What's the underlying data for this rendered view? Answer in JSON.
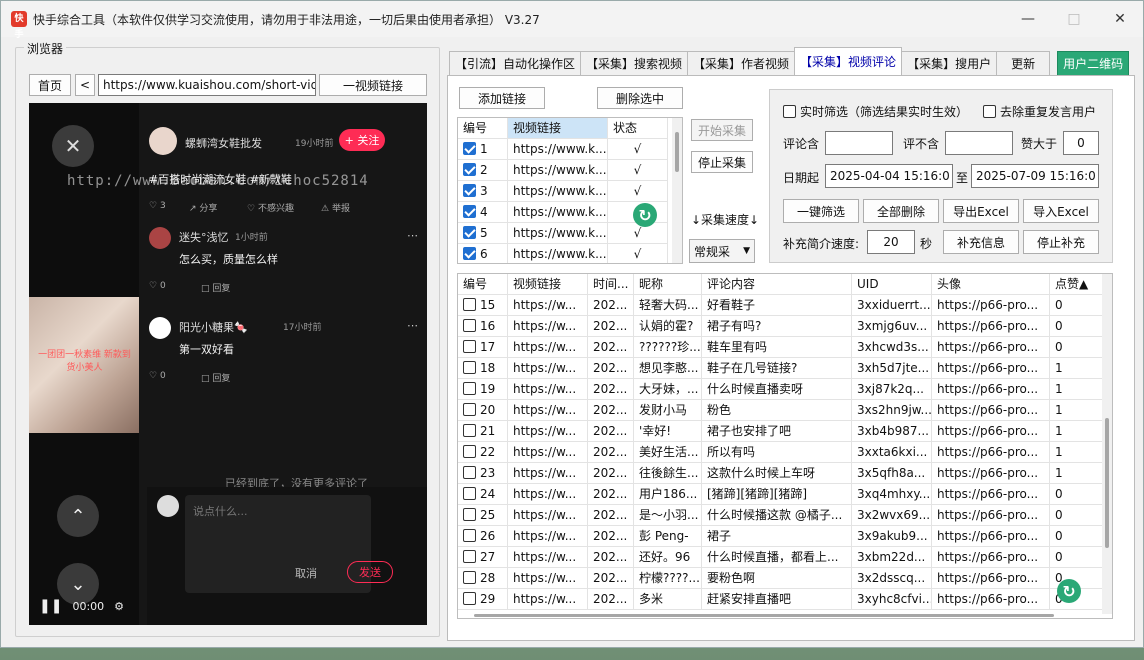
{
  "window": {
    "title": "快手综合工具（本软件仅供学习交流使用，请勿用于非法用途，一切后果由使用者承担） V3.27",
    "icon_label": "快手"
  },
  "browser": {
    "group_label": "浏览器",
    "home_label": "首页",
    "back_label": "<",
    "url_value": "https://www.kuaishou.com/short-vide",
    "go_label": "一视频链接",
    "overlay_url": "http://www.baoban.com/ichoc52814",
    "thumb_text": "一团团一秋素维 新款到货小美人",
    "time_label": "00:00",
    "comments": [
      {
        "name": "螺蛳湾女鞋批发",
        "time": "19小时前",
        "text": "#百搭时尚潮流女鞋 #新款鞋",
        "likes": "3",
        "share": "分享",
        "dislike": "不感兴趣",
        "report": "举报"
      },
      {
        "name": "迷失°浅忆",
        "time": "1小时前",
        "text": "怎么买，质量怎么样",
        "likes": "0",
        "reply": "回复"
      },
      {
        "name": "阳光小糖果🍬",
        "time": "17小时前",
        "text": "第一双好看",
        "likes": "0",
        "reply": "回复"
      }
    ],
    "follow_label": "+ 关注",
    "end_text": "已经到底了，没有更多评论了",
    "comment_placeholder": "说点什么...",
    "cancel_label": "取消",
    "send_label": "发送"
  },
  "tabs": [
    {
      "label": "【引流】自动化操作区",
      "active": false
    },
    {
      "label": "【采集】搜索视频",
      "active": false
    },
    {
      "label": "【采集】作者视频",
      "active": false
    },
    {
      "label": "【采集】视频评论",
      "active": true
    },
    {
      "label": "【采集】搜用户",
      "active": false
    },
    {
      "label": "更新",
      "active": false
    }
  ],
  "qr_button": "用户二维码",
  "video_list": {
    "add_label": "添加链接",
    "delete_label": "删除选中",
    "columns": [
      "编号",
      "视频链接",
      "状态"
    ],
    "rows": [
      {
        "no": "1",
        "link": "https://www.k...",
        "status": "√"
      },
      {
        "no": "2",
        "link": "https://www.k...",
        "status": "√"
      },
      {
        "no": "3",
        "link": "https://www.k...",
        "status": "√"
      },
      {
        "no": "4",
        "link": "https://www.k...",
        "status": "√"
      },
      {
        "no": "5",
        "link": "https://www.k...",
        "status": "√"
      },
      {
        "no": "6",
        "link": "https://www.k...",
        "status": "√"
      }
    ]
  },
  "controls": {
    "start_label": "开始采集",
    "stop_label": "停止采集",
    "speed_label": "↓采集速度↓",
    "speed_value": "常规采"
  },
  "filters": {
    "realtime_label": "实时筛选（筛选结果实时生效）",
    "dedupe_label": "去除重复发言用户",
    "include_label": "评论含",
    "exclude_label": "评不含",
    "likes_label": "赞大于",
    "likes_value": "0",
    "date_from_label": "日期起",
    "date_from": "2025-04-04 15:16:0",
    "date_to_label": "至",
    "date_to": "2025-07-09 15:16:0",
    "filter_label": "一键筛选",
    "delete_all_label": "全部删除",
    "export_label": "导出Excel",
    "import_label": "导入Excel",
    "speed_label": "补充简介速度:",
    "speed_value": "20",
    "speed_unit": "秒",
    "supplement_label": "补充信息",
    "stop_supplement_label": "停止补充"
  },
  "results": {
    "columns": [
      "编号",
      "视频链接",
      "时间...",
      "昵称",
      "评论内容",
      "UID",
      "头像",
      "点赞▲"
    ],
    "rows": [
      {
        "no": "15",
        "link": "https://w...",
        "time": "202...",
        "nick": "轻奢大码...",
        "content": "好看鞋子",
        "uid": "3xxiduerrt...",
        "avatar": "https://p66-pro...",
        "likes": "0"
      },
      {
        "no": "16",
        "link": "https://w...",
        "time": "202...",
        "nick": "认娟的霍?",
        "content": "裙子有吗?",
        "uid": "3xmjg6uv...",
        "avatar": "https://p66-pro...",
        "likes": "0"
      },
      {
        "no": "17",
        "link": "https://w...",
        "time": "202...",
        "nick": "??????珍...",
        "content": "鞋车里有吗",
        "uid": "3xhcwd3s...",
        "avatar": "https://p66-pro...",
        "likes": "0"
      },
      {
        "no": "18",
        "link": "https://w...",
        "time": "202...",
        "nick": "想见李憨...",
        "content": "鞋子在几号链接?",
        "uid": "3xh5d7jte...",
        "avatar": "https://p66-pro...",
        "likes": "1"
      },
      {
        "no": "19",
        "link": "https://w...",
        "time": "202...",
        "nick": "大牙妹，...",
        "content": "什么时候直播卖呀",
        "uid": "3xj87k2q...",
        "avatar": "https://p66-pro...",
        "likes": "1"
      },
      {
        "no": "20",
        "link": "https://w...",
        "time": "202...",
        "nick": "发财小马",
        "content": "粉色",
        "uid": "3xs2hn9jw...",
        "avatar": "https://p66-pro...",
        "likes": "1"
      },
      {
        "no": "21",
        "link": "https://w...",
        "time": "202...",
        "nick": "'幸好!",
        "content": "裙子也安排了吧",
        "uid": "3xb4b987...",
        "avatar": "https://p66-pro...",
        "likes": "1"
      },
      {
        "no": "22",
        "link": "https://w...",
        "time": "202...",
        "nick": "美好生活...",
        "content": "所以有吗",
        "uid": "3xxta6kxi...",
        "avatar": "https://p66-pro...",
        "likes": "1"
      },
      {
        "no": "23",
        "link": "https://w...",
        "time": "202...",
        "nick": "往後餘生...",
        "content": "这款什么时候上车呀",
        "uid": "3x5qfh8a...",
        "avatar": "https://p66-pro...",
        "likes": "1"
      },
      {
        "no": "24",
        "link": "https://w...",
        "time": "202...",
        "nick": "用户186...",
        "content": "[猪蹄][猪蹄][猪蹄]",
        "uid": "3xq4mhxy...",
        "avatar": "https://p66-pro...",
        "likes": "0"
      },
      {
        "no": "25",
        "link": "https://w...",
        "time": "202...",
        "nick": "是～小羽...",
        "content": "什么时候播这款 @橘子...",
        "uid": "3x2wvx69...",
        "avatar": "https://p66-pro...",
        "likes": "0"
      },
      {
        "no": "26",
        "link": "https://w...",
        "time": "202...",
        "nick": "彭 Peng-",
        "content": "裙子",
        "uid": "3x9akub9...",
        "avatar": "https://p66-pro...",
        "likes": "0"
      },
      {
        "no": "27",
        "link": "https://w...",
        "time": "202...",
        "nick": "还好。96",
        "content": "什么时候直播，都看上...",
        "uid": "3xbm22d...",
        "avatar": "https://p66-pro...",
        "likes": "0"
      },
      {
        "no": "28",
        "link": "https://w...",
        "time": "202...",
        "nick": "柠檬????...",
        "content": "要粉色啊",
        "uid": "3x2dsscq...",
        "avatar": "https://p66-pro...",
        "likes": "0"
      },
      {
        "no": "29",
        "link": "https://w...",
        "time": "202...",
        "nick": "多米",
        "content": "赶紧安排直播吧",
        "uid": "3xyhc8cfvi...",
        "avatar": "https://p66-pro...",
        "likes": "0"
      }
    ]
  }
}
